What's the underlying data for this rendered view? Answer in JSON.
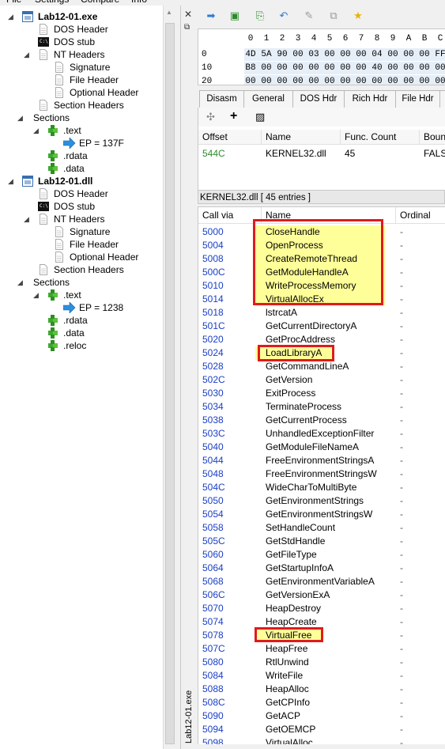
{
  "menubar": {
    "items": [
      "File",
      "Settings",
      "Compare",
      "Info"
    ]
  },
  "tree": {
    "nodes": [
      {
        "label": "Lab12-01.exe",
        "icon": "exe-file-icon",
        "level": 0,
        "expander": "◢",
        "bold": true
      },
      {
        "label": "DOS Header",
        "icon": "document-icon",
        "level": 1
      },
      {
        "label": "DOS stub",
        "icon": "console-icon",
        "level": 1
      },
      {
        "label": "NT Headers",
        "icon": "document-icon",
        "level": 1,
        "expander": "◢"
      },
      {
        "label": "Signature",
        "icon": "document-icon",
        "level": 2
      },
      {
        "label": "File Header",
        "icon": "document-icon",
        "level": 2
      },
      {
        "label": "Optional Header",
        "icon": "document-icon",
        "level": 2
      },
      {
        "label": "Section Headers",
        "icon": "document-icon",
        "level": 1
      },
      {
        "label": "Sections",
        "icon": "",
        "level": 0.6,
        "expander": "◢"
      },
      {
        "label": ".text",
        "icon": "puzzle-icon",
        "level": 1.6,
        "expander": "◢"
      },
      {
        "label": "EP = 137F",
        "icon": "arrow-icon",
        "level": 2.6
      },
      {
        "label": ".rdata",
        "icon": "puzzle-icon",
        "level": 1.6
      },
      {
        "label": ".data",
        "icon": "puzzle-icon",
        "level": 1.6
      },
      {
        "label": "Lab12-01.dll",
        "icon": "dll-file-icon",
        "level": 0,
        "expander": "◢",
        "bold": true
      },
      {
        "label": "DOS Header",
        "icon": "document-icon",
        "level": 1
      },
      {
        "label": "DOS stub",
        "icon": "console-icon",
        "level": 1
      },
      {
        "label": "NT Headers",
        "icon": "document-icon",
        "level": 1,
        "expander": "◢"
      },
      {
        "label": "Signature",
        "icon": "document-icon",
        "level": 2
      },
      {
        "label": "File Header",
        "icon": "document-icon",
        "level": 2
      },
      {
        "label": "Optional Header",
        "icon": "document-icon",
        "level": 2
      },
      {
        "label": "Section Headers",
        "icon": "document-icon",
        "level": 1
      },
      {
        "label": "Sections",
        "icon": "",
        "level": 0.6,
        "expander": "◢"
      },
      {
        "label": ".text",
        "icon": "puzzle-icon",
        "level": 1.6,
        "expander": "◢"
      },
      {
        "label": "EP = 1238",
        "icon": "arrow-icon",
        "level": 2.6
      },
      {
        "label": ".rdata",
        "icon": "puzzle-icon",
        "level": 1.6
      },
      {
        "label": ".data",
        "icon": "puzzle-icon",
        "level": 1.6
      },
      {
        "label": ".reloc",
        "icon": "puzzle-icon",
        "level": 1.6
      }
    ]
  },
  "vertical_tab": {
    "label": "Lab12-01.exe",
    "close": "✕",
    "pin": "⧉"
  },
  "toolbar": {
    "icons": [
      "arrow-right-icon",
      "save-icon",
      "export-icon",
      "undo-icon",
      "pin-icon",
      "compare-icon",
      "star-icon"
    ]
  },
  "hex": {
    "columns": [
      "0",
      "1",
      "2",
      "3",
      "4",
      "5",
      "6",
      "7",
      "8",
      "9",
      "A",
      "B",
      "C"
    ],
    "rows": [
      {
        "offset": "0",
        "bytes": [
          "4D",
          "5A",
          "90",
          "00",
          "03",
          "00",
          "00",
          "00",
          "04",
          "00",
          "00",
          "00",
          "FF"
        ]
      },
      {
        "offset": "10",
        "bytes": [
          "B8",
          "00",
          "00",
          "00",
          "00",
          "00",
          "00",
          "00",
          "40",
          "00",
          "00",
          "00",
          "00"
        ]
      },
      {
        "offset": "20",
        "bytes": [
          "00",
          "00",
          "00",
          "00",
          "00",
          "00",
          "00",
          "00",
          "00",
          "00",
          "00",
          "00",
          "00"
        ]
      }
    ]
  },
  "tabs": [
    "Disasm",
    "General",
    "DOS Hdr",
    "Rich Hdr",
    "File Hdr",
    ""
  ],
  "imports_panel": {
    "headers": [
      "Offset",
      "Name",
      "Func. Count",
      "Boun"
    ],
    "rows": [
      {
        "offset": "544C",
        "name": "KERNEL32.dll",
        "count": "45",
        "bound": "FALSE"
      }
    ]
  },
  "entries_label": "KERNEL32.dll  [ 45 entries ]",
  "func_list": {
    "headers": [
      "Call via",
      "Name",
      "Ordinal"
    ],
    "rows": [
      {
        "call": "5000",
        "name": "CloseHandle",
        "ord": "-"
      },
      {
        "call": "5004",
        "name": "OpenProcess",
        "ord": "-"
      },
      {
        "call": "5008",
        "name": "CreateRemoteThread",
        "ord": "-"
      },
      {
        "call": "500C",
        "name": "GetModuleHandleA",
        "ord": "-"
      },
      {
        "call": "5010",
        "name": "WriteProcessMemory",
        "ord": "-"
      },
      {
        "call": "5014",
        "name": "VirtualAllocEx",
        "ord": "-"
      },
      {
        "call": "5018",
        "name": "lstrcatA",
        "ord": "-"
      },
      {
        "call": "501C",
        "name": "GetCurrentDirectoryA",
        "ord": "-"
      },
      {
        "call": "5020",
        "name": "GetProcAddress",
        "ord": "-"
      },
      {
        "call": "5024",
        "name": "LoadLibraryA",
        "ord": "-"
      },
      {
        "call": "5028",
        "name": "GetCommandLineA",
        "ord": "-"
      },
      {
        "call": "502C",
        "name": "GetVersion",
        "ord": "-"
      },
      {
        "call": "5030",
        "name": "ExitProcess",
        "ord": "-"
      },
      {
        "call": "5034",
        "name": "TerminateProcess",
        "ord": "-"
      },
      {
        "call": "5038",
        "name": "GetCurrentProcess",
        "ord": "-"
      },
      {
        "call": "503C",
        "name": "UnhandledExceptionFilter",
        "ord": "-"
      },
      {
        "call": "5040",
        "name": "GetModuleFileNameA",
        "ord": "-"
      },
      {
        "call": "5044",
        "name": "FreeEnvironmentStringsA",
        "ord": "-"
      },
      {
        "call": "5048",
        "name": "FreeEnvironmentStringsW",
        "ord": "-"
      },
      {
        "call": "504C",
        "name": "WideCharToMultiByte",
        "ord": "-"
      },
      {
        "call": "5050",
        "name": "GetEnvironmentStrings",
        "ord": "-"
      },
      {
        "call": "5054",
        "name": "GetEnvironmentStringsW",
        "ord": "-"
      },
      {
        "call": "5058",
        "name": "SetHandleCount",
        "ord": "-"
      },
      {
        "call": "505C",
        "name": "GetStdHandle",
        "ord": "-"
      },
      {
        "call": "5060",
        "name": "GetFileType",
        "ord": "-"
      },
      {
        "call": "5064",
        "name": "GetStartupInfoA",
        "ord": "-"
      },
      {
        "call": "5068",
        "name": "GetEnvironmentVariableA",
        "ord": "-"
      },
      {
        "call": "506C",
        "name": "GetVersionExA",
        "ord": "-"
      },
      {
        "call": "5070",
        "name": "HeapDestroy",
        "ord": "-"
      },
      {
        "call": "5074",
        "name": "HeapCreate",
        "ord": "-"
      },
      {
        "call": "5078",
        "name": "VirtualFree",
        "ord": "-"
      },
      {
        "call": "507C",
        "name": "HeapFree",
        "ord": "-"
      },
      {
        "call": "5080",
        "name": "RtlUnwind",
        "ord": "-"
      },
      {
        "call": "5084",
        "name": "WriteFile",
        "ord": "-"
      },
      {
        "call": "5088",
        "name": "HeapAlloc",
        "ord": "-"
      },
      {
        "call": "508C",
        "name": "GetCPInfo",
        "ord": "-"
      },
      {
        "call": "5090",
        "name": "GetACP",
        "ord": "-"
      },
      {
        "call": "5094",
        "name": "GetOEMCP",
        "ord": "-"
      },
      {
        "call": "5098",
        "name": "VirtualAlloc",
        "ord": "-"
      }
    ],
    "highlighted": [
      0,
      1,
      2,
      3,
      4,
      5,
      9,
      30
    ]
  },
  "colors": {
    "accent": "#1a3ec8",
    "highlight": "#ffff99",
    "annotation": "#e01b1b",
    "offset_green": "#2e8b2e"
  }
}
